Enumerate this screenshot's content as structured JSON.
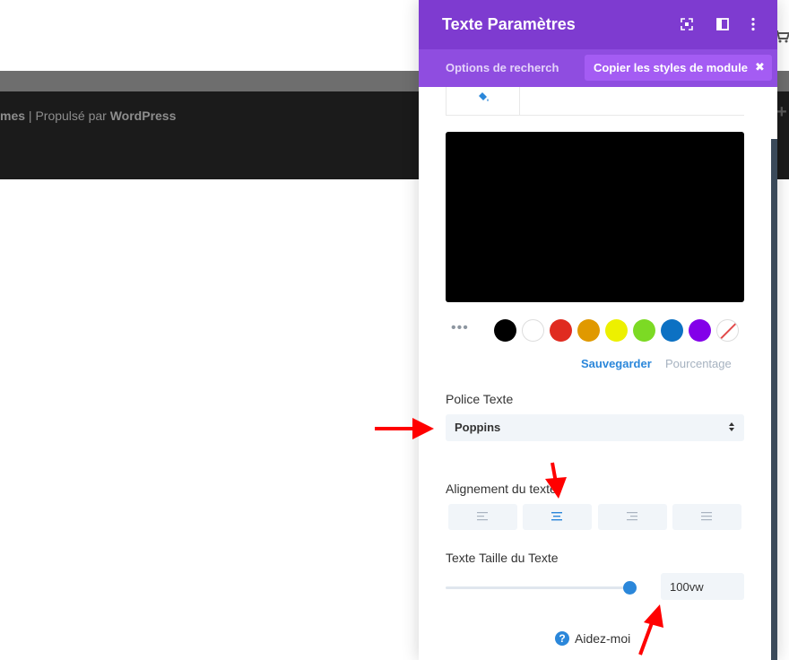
{
  "footer": {
    "prefix": "mes",
    "separator": " | Propulsé par ",
    "brand": "WordPress"
  },
  "panel": {
    "title": "Texte Paramètres",
    "search_tab": "Options de recherche",
    "copy_styles_label": "Copier les styles de module",
    "copy_close": "✖",
    "color": {
      "swatches": [
        "#000000",
        "#ffffff",
        "#e02b20",
        "#e09900",
        "#edf000",
        "#7cda24",
        "#0c71c3",
        "#8300e9",
        "none"
      ],
      "save_link": "Sauvegarder",
      "percent_link": "Pourcentage"
    },
    "font": {
      "label": "Police Texte",
      "value": "Poppins"
    },
    "alignment": {
      "label": "Alignement du texte",
      "options": [
        "left",
        "center",
        "right",
        "justify"
      ],
      "selected": "center"
    },
    "size": {
      "label": "Texte Taille du Texte",
      "value": "100vw",
      "slider_level": 1.0
    },
    "help_label": "Aidez-moi"
  },
  "colors": {
    "header": "#7e3bd0",
    "tabs": "#8f4de0",
    "accent": "#2b87da",
    "annotation_arrow": "#ff0000"
  }
}
